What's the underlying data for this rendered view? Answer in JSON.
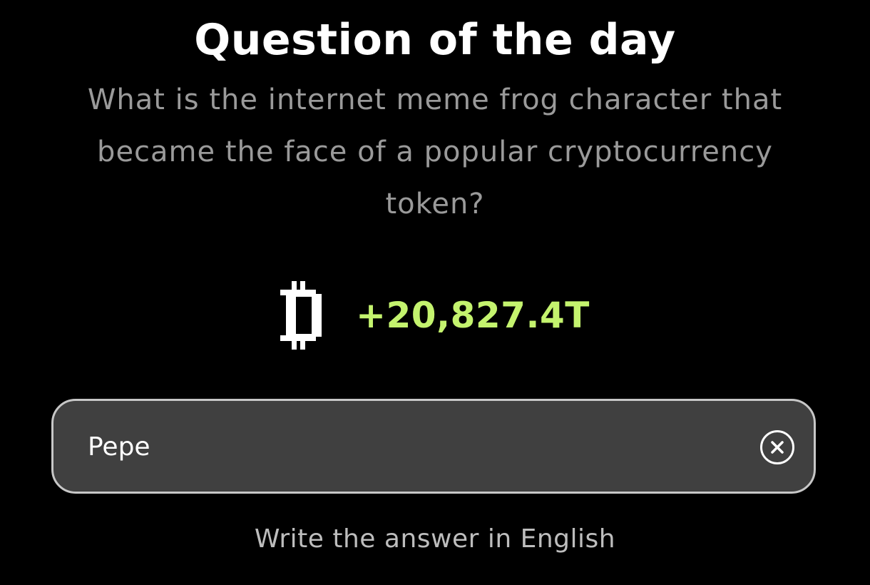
{
  "title": "Question of the day",
  "question": "What is the internet meme frog character that became the face of a popular cryptocurrency token?",
  "reward": {
    "icon": "bitcoin-coin-icon",
    "amount": "+20,827.4T",
    "amount_color": "#c4f36e"
  },
  "answer": {
    "value": "Pepe",
    "clear_icon": "close-circle-icon"
  },
  "hint": "Write the answer in English",
  "colors": {
    "background": "#000000",
    "input_background": "#404040",
    "input_border": "#c7c7c7"
  }
}
